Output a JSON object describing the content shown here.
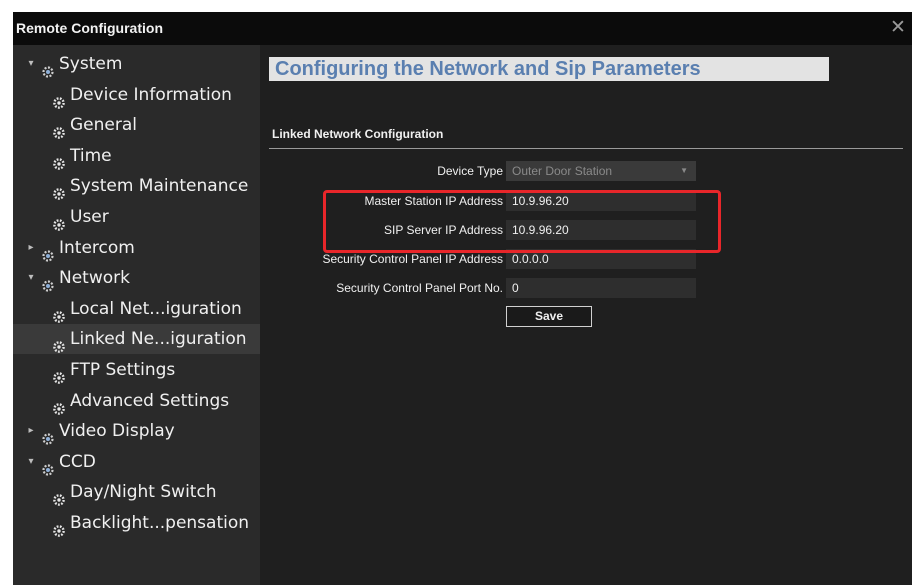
{
  "window": {
    "title": "Remote Configuration",
    "close_glyph": "✕"
  },
  "sidebar": {
    "items": [
      {
        "label": "System",
        "level": 0,
        "expanded": true,
        "icon": "gear-group-icon"
      },
      {
        "label": "Device Information",
        "level": 1,
        "icon": "gear-icon"
      },
      {
        "label": "General",
        "level": 1,
        "icon": "gear-icon"
      },
      {
        "label": "Time",
        "level": 1,
        "icon": "gear-icon"
      },
      {
        "label": "System Maintenance",
        "level": 1,
        "icon": "gear-icon"
      },
      {
        "label": "User",
        "level": 1,
        "icon": "gear-icon"
      },
      {
        "label": "Intercom",
        "level": 0,
        "expanded": false,
        "icon": "gear-group-icon"
      },
      {
        "label": "Network",
        "level": 0,
        "expanded": true,
        "icon": "gear-group-icon"
      },
      {
        "label": "Local Net...iguration",
        "level": 1,
        "icon": "gear-icon"
      },
      {
        "label": "Linked Ne...iguration",
        "level": 1,
        "icon": "gear-icon",
        "selected": true
      },
      {
        "label": "FTP Settings",
        "level": 1,
        "icon": "gear-icon"
      },
      {
        "label": "Advanced Settings",
        "level": 1,
        "icon": "gear-icon"
      },
      {
        "label": "Video Display",
        "level": 0,
        "expanded": false,
        "icon": "gear-group-icon"
      },
      {
        "label": "CCD",
        "level": 0,
        "expanded": true,
        "icon": "gear-group-icon"
      },
      {
        "label": "Day/Night Switch",
        "level": 1,
        "icon": "gear-icon"
      },
      {
        "label": "Backlight...pensation",
        "level": 1,
        "icon": "gear-icon"
      }
    ]
  },
  "main": {
    "page_title": "Configuring the Network and Sip Parameters",
    "section_title": "Linked Network Configuration",
    "fields": [
      {
        "label": "Device Type",
        "value": "Outer Door Station",
        "type": "select"
      },
      {
        "label": "Master Station IP Address",
        "value": "10.9.96.20",
        "type": "input"
      },
      {
        "label": "SIP Server IP Address",
        "value": "10.9.96.20",
        "type": "input"
      },
      {
        "label": "Security Control Panel IP Address",
        "value": "0.0.0.0",
        "type": "input"
      },
      {
        "label": "Security Control Panel Port No.",
        "value": "0",
        "type": "input"
      }
    ],
    "save_label": "Save"
  },
  "colors": {
    "highlight": "#e8262a",
    "header_title": "#5a7fb0"
  }
}
